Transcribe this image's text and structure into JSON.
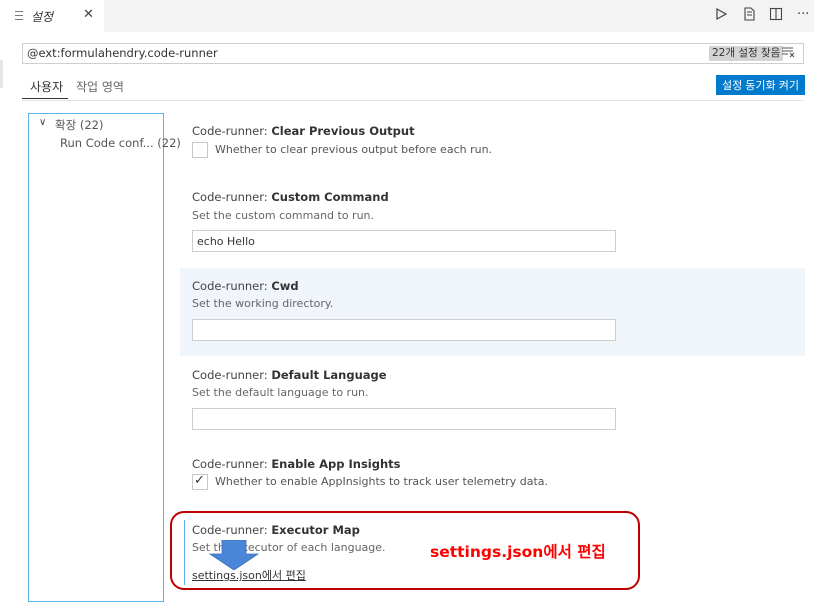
{
  "tab": {
    "title": "설정",
    "icon": "settings-file-icon",
    "close_icon": "close-icon"
  },
  "toolbar": {
    "icons": [
      "run-icon",
      "open-settings-json-icon",
      "split-editor-icon",
      "more-actions-icon"
    ]
  },
  "search": {
    "value": "@ext:formulahendry.code-runner",
    "result_count": "22개 설정 찾음",
    "filter_icon": "clear-filter-icon"
  },
  "scope_tabs": {
    "user": "사용자",
    "workspace": "작업 영역"
  },
  "sync_button": "설정 동기화 켜기",
  "toc": {
    "group_label": "확장",
    "group_count": "(22)",
    "item_label": "Run Code conf...",
    "item_count": "(22)"
  },
  "settings": [
    {
      "prefix": "Code-runner: ",
      "name": "Clear Previous Output",
      "checkbox_label": "Whether to clear previous output before each run.",
      "checked": false
    },
    {
      "prefix": "Code-runner: ",
      "name": "Custom Command",
      "description": "Set the custom command to run.",
      "value": "echo Hello"
    },
    {
      "prefix": "Code-runner: ",
      "name": "Cwd",
      "description": "Set the working directory.",
      "value": ""
    },
    {
      "prefix": "Code-runner: ",
      "name": "Default Language",
      "description": "Set the default language to run.",
      "value": ""
    },
    {
      "prefix": "Code-runner: ",
      "name": "Enable App Insights",
      "checkbox_label": "Whether to enable AppInsights to track user telemetry data.",
      "checked": true
    },
    {
      "prefix": "Code-runner: ",
      "name": "Executor Map",
      "description": "Set the executor of each language.",
      "edit_link": "settings.json에서 편집"
    }
  ],
  "annotation": {
    "callout_text": "settings.json에서 편집",
    "callout_color": "#ff0000",
    "box_color": "#c00000",
    "arrow_color": "#4a86d8"
  },
  "colors": {
    "accent": "#007acc",
    "focus_border": "#5bb4e9",
    "highlight_row": "#f0f5fb"
  }
}
